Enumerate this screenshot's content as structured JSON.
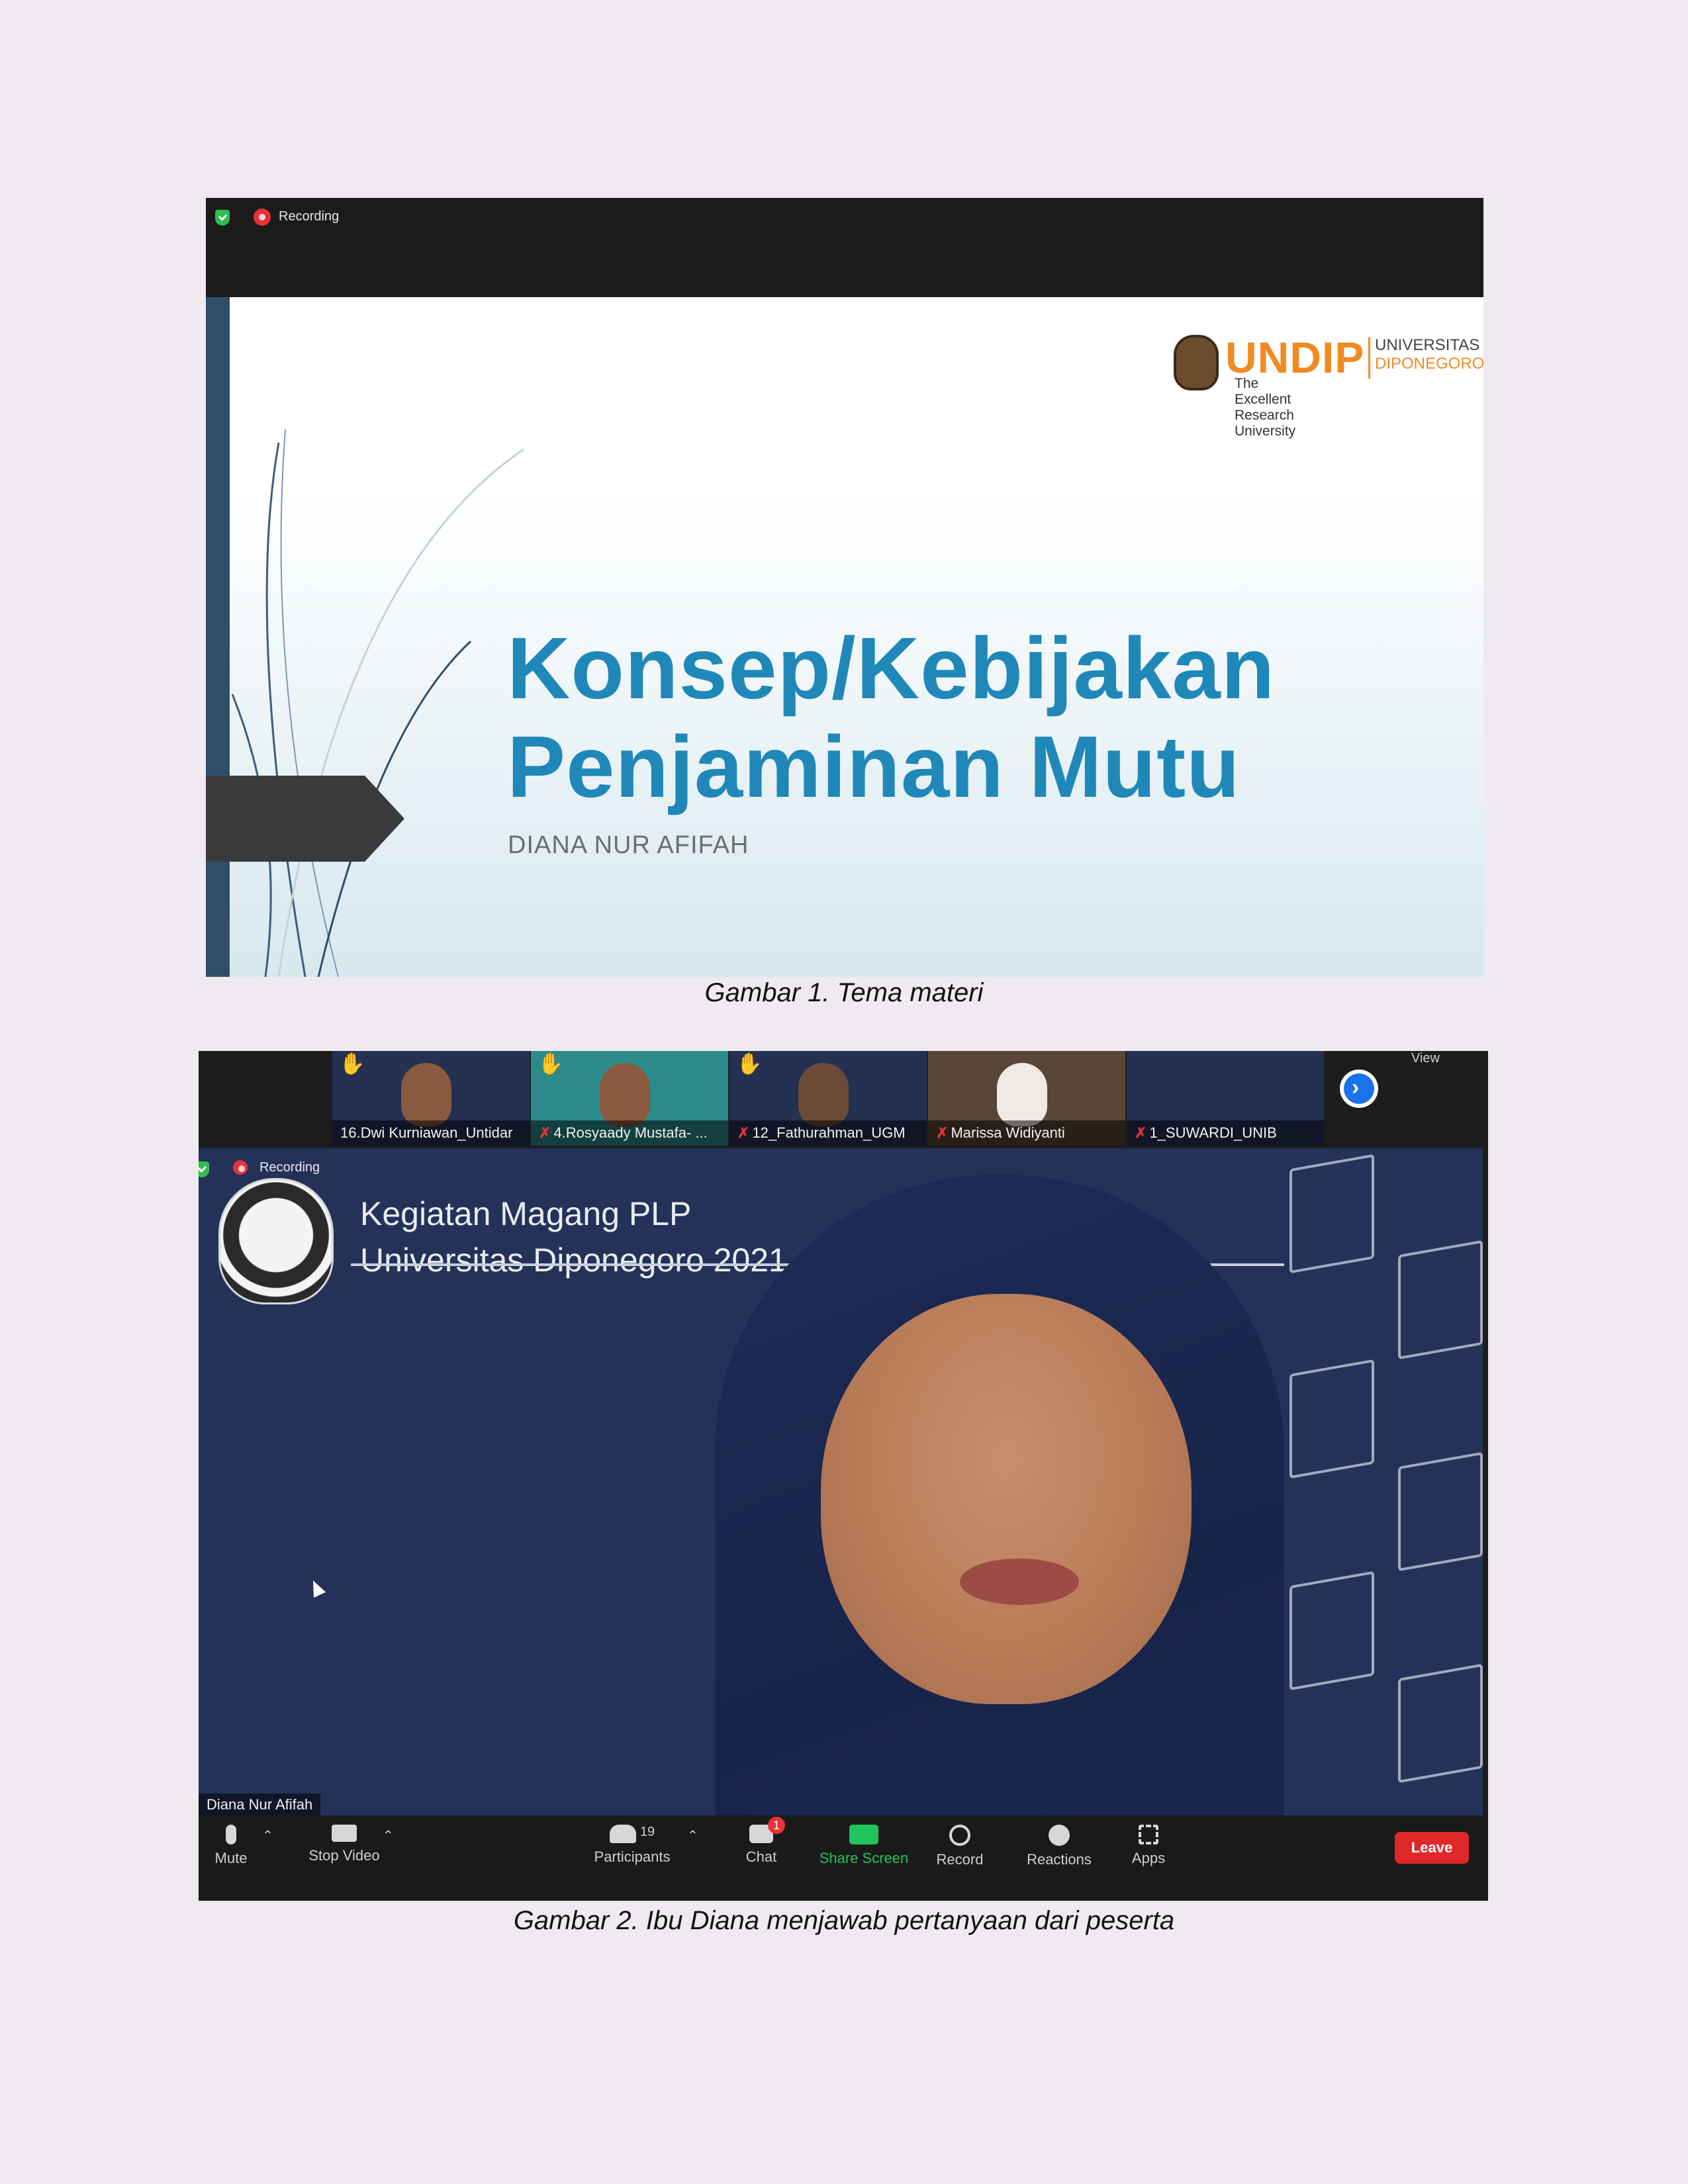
{
  "figure1": {
    "recording_label": "Recording",
    "logo": {
      "name": "UNDIP",
      "univ_line1": "UNIVERSITAS",
      "univ_line2": "DIPONEGORO",
      "tagline": "The Excellent Research University"
    },
    "slide_title_line1": "Konsep/Kebijakan",
    "slide_title_line2": "Penjaminan Mutu",
    "slide_author": "DIANA NUR AFIFAH",
    "caption": "Gambar 1. Tema materi"
  },
  "figure2": {
    "view_label": "View",
    "thumbnails": [
      {
        "name": "16.Dwi Kurniawan_Untidar",
        "muted": false,
        "hand_raised": true
      },
      {
        "name": "4.Rosyaady Mustafa- ...",
        "muted": true,
        "hand_raised": true
      },
      {
        "name": "12_Fathurahman_UGM",
        "muted": true,
        "hand_raised": true
      },
      {
        "name": "Marissa Widiyanti",
        "muted": true,
        "hand_raised": false
      },
      {
        "name": "1_SUWARDI_UNIB",
        "muted": true,
        "hand_raised": false
      }
    ],
    "recording_label": "Recording",
    "background_title_line1": "Kegiatan Magang PLP",
    "background_title_line2": "Universitas Diponegoro 2021",
    "speaker_name": "Diana Nur Afifah",
    "controls": {
      "mute": "Mute",
      "stop_video": "Stop Video",
      "participants": "Participants",
      "participants_count": "19",
      "chat": "Chat",
      "chat_badge": "1",
      "share_screen": "Share Screen",
      "record": "Record",
      "reactions": "Reactions",
      "apps": "Apps",
      "leave": "Leave"
    },
    "caption": "Gambar 2. Ibu Diana menjawab pertanyaan dari peserta"
  },
  "colors": {
    "page_bg": "#eeeaef",
    "slide_title": "#1f88b8",
    "undip_orange": "#f08b24",
    "leave_red": "#e02828",
    "share_green": "#1fc45b"
  }
}
